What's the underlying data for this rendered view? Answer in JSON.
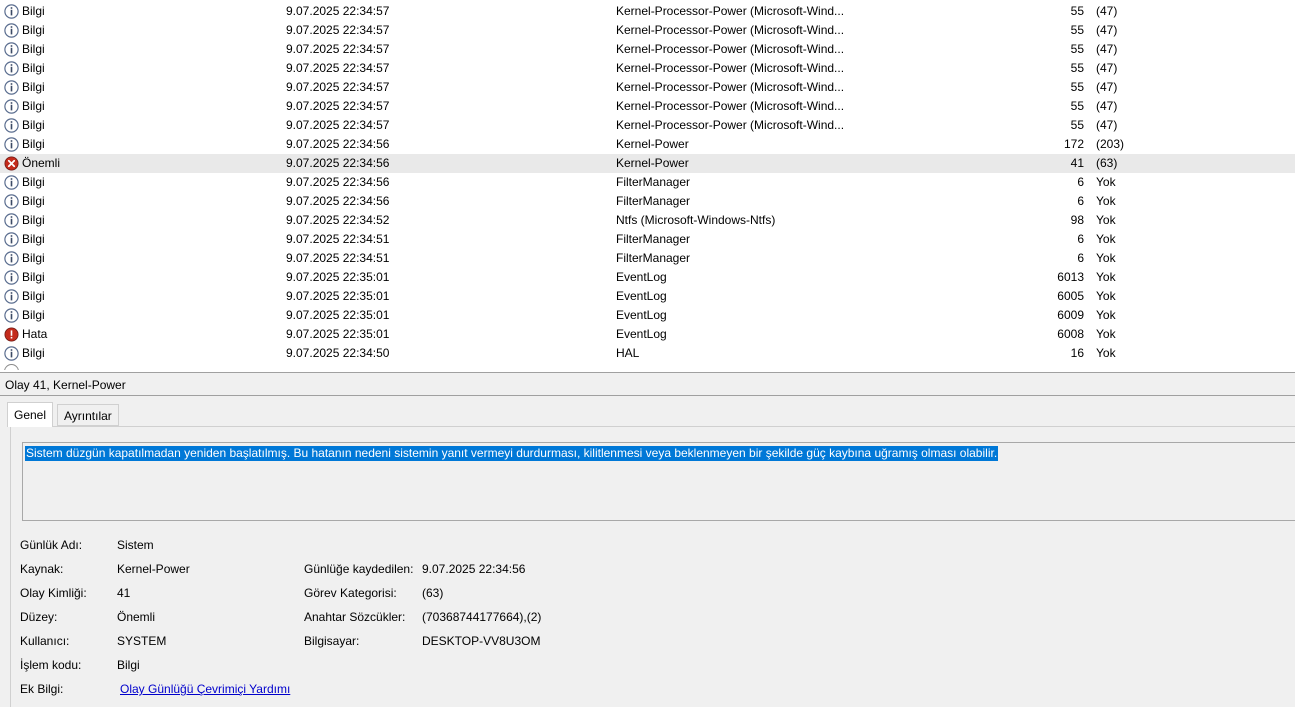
{
  "events": [
    {
      "level": "Bilgi",
      "type": "info",
      "date": "9.07.2025 22:34:57",
      "source": "Kernel-Processor-Power (Microsoft-Wind...",
      "id": "55",
      "category": "(47)"
    },
    {
      "level": "Bilgi",
      "type": "info",
      "date": "9.07.2025 22:34:57",
      "source": "Kernel-Processor-Power (Microsoft-Wind...",
      "id": "55",
      "category": "(47)"
    },
    {
      "level": "Bilgi",
      "type": "info",
      "date": "9.07.2025 22:34:57",
      "source": "Kernel-Processor-Power (Microsoft-Wind...",
      "id": "55",
      "category": "(47)"
    },
    {
      "level": "Bilgi",
      "type": "info",
      "date": "9.07.2025 22:34:57",
      "source": "Kernel-Processor-Power (Microsoft-Wind...",
      "id": "55",
      "category": "(47)"
    },
    {
      "level": "Bilgi",
      "type": "info",
      "date": "9.07.2025 22:34:57",
      "source": "Kernel-Processor-Power (Microsoft-Wind...",
      "id": "55",
      "category": "(47)"
    },
    {
      "level": "Bilgi",
      "type": "info",
      "date": "9.07.2025 22:34:57",
      "source": "Kernel-Processor-Power (Microsoft-Wind...",
      "id": "55",
      "category": "(47)"
    },
    {
      "level": "Bilgi",
      "type": "info",
      "date": "9.07.2025 22:34:57",
      "source": "Kernel-Processor-Power (Microsoft-Wind...",
      "id": "55",
      "category": "(47)"
    },
    {
      "level": "Bilgi",
      "type": "info",
      "date": "9.07.2025 22:34:56",
      "source": "Kernel-Power",
      "id": "172",
      "category": "(203)"
    },
    {
      "level": "Önemli",
      "type": "critical",
      "date": "9.07.2025 22:34:56",
      "source": "Kernel-Power",
      "id": "41",
      "category": "(63)",
      "selected": true
    },
    {
      "level": "Bilgi",
      "type": "info",
      "date": "9.07.2025 22:34:56",
      "source": "FilterManager",
      "id": "6",
      "category": "Yok"
    },
    {
      "level": "Bilgi",
      "type": "info",
      "date": "9.07.2025 22:34:56",
      "source": "FilterManager",
      "id": "6",
      "category": "Yok"
    },
    {
      "level": "Bilgi",
      "type": "info",
      "date": "9.07.2025 22:34:52",
      "source": "Ntfs (Microsoft-Windows-Ntfs)",
      "id": "98",
      "category": "Yok"
    },
    {
      "level": "Bilgi",
      "type": "info",
      "date": "9.07.2025 22:34:51",
      "source": "FilterManager",
      "id": "6",
      "category": "Yok"
    },
    {
      "level": "Bilgi",
      "type": "info",
      "date": "9.07.2025 22:34:51",
      "source": "FilterManager",
      "id": "6",
      "category": "Yok"
    },
    {
      "level": "Bilgi",
      "type": "info",
      "date": "9.07.2025 22:35:01",
      "source": "EventLog",
      "id": "6013",
      "category": "Yok"
    },
    {
      "level": "Bilgi",
      "type": "info",
      "date": "9.07.2025 22:35:01",
      "source": "EventLog",
      "id": "6005",
      "category": "Yok"
    },
    {
      "level": "Bilgi",
      "type": "info",
      "date": "9.07.2025 22:35:01",
      "source": "EventLog",
      "id": "6009",
      "category": "Yok"
    },
    {
      "level": "Hata",
      "type": "error",
      "date": "9.07.2025 22:35:01",
      "source": "EventLog",
      "id": "6008",
      "category": "Yok"
    },
    {
      "level": "Bilgi",
      "type": "info",
      "date": "9.07.2025 22:34:50",
      "source": "HAL",
      "id": "16",
      "category": "Yok"
    }
  ],
  "details": {
    "title": "Olay 41, Kernel-Power",
    "tabs": {
      "general": "Genel",
      "details": "Ayrıntılar"
    },
    "description": "Sistem düzgün kapatılmadan yeniden başlatılmış. Bu hatanın nedeni sistemin yanıt vermeyi durdurması, kilitlenmesi veya beklenmeyen bir şekilde güç kaybına uğramış olması olabilir.",
    "fields": {
      "log_name_label": "Günlük Adı:",
      "log_name": "Sistem",
      "source_label": "Kaynak:",
      "source": "Kernel-Power",
      "event_id_label": "Olay Kimliği:",
      "event_id": "41",
      "level_label": "Düzey:",
      "level": "Önemli",
      "user_label": "Kullanıcı:",
      "user": "SYSTEM",
      "opcode_label": "İşlem kodu:",
      "opcode": "Bilgi",
      "more_info_label": "Ek Bilgi:",
      "more_info_link": "Olay Günlüğü Çevrimiçi Yardımı",
      "logged_label": "Günlüğe kaydedilen:",
      "logged": "9.07.2025 22:34:56",
      "task_category_label": "Görev Kategorisi:",
      "task_category": "(63)",
      "keywords_label": "Anahtar Sözcükler:",
      "keywords": "(70368744177664),(2)",
      "computer_label": "Bilgisayar:",
      "computer": "DESKTOP-VV8U3OM"
    }
  },
  "colors": {
    "selection": "#0078d7",
    "selected_row": "#e9e9e9",
    "critical": "#c42b1c",
    "error": "#c42b1c",
    "info": "#5a6d8f"
  }
}
